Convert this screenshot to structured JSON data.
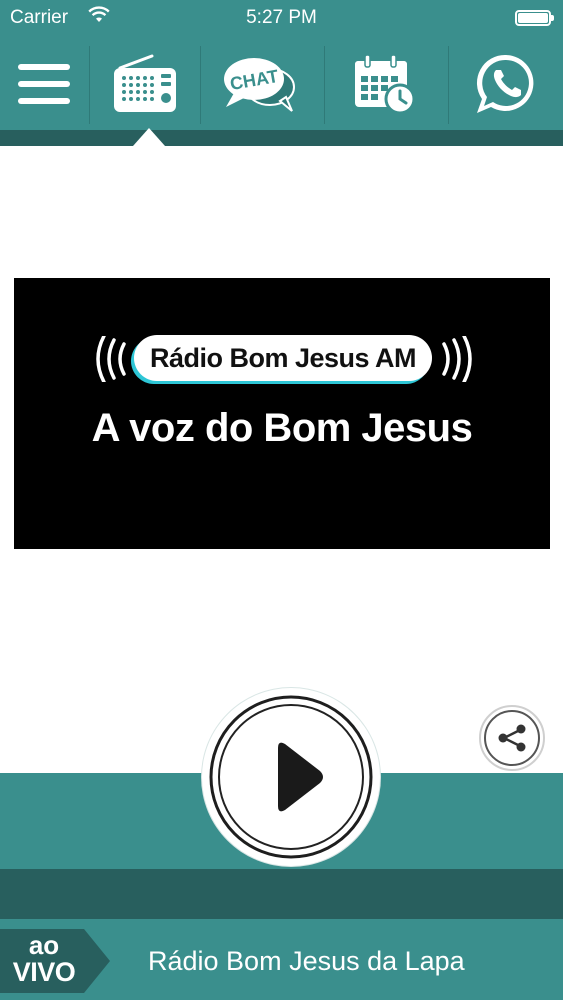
{
  "status_bar": {
    "carrier": "Carrier",
    "time": "5:27 PM"
  },
  "toolbar": {
    "tabs": [
      {
        "icon": "menu-icon"
      },
      {
        "icon": "radio-icon",
        "selected": true
      },
      {
        "icon": "chat-icon",
        "label": "CHAT"
      },
      {
        "icon": "calendar-icon"
      },
      {
        "icon": "whatsapp-icon"
      }
    ]
  },
  "banner": {
    "station_name": "Rádio Bom Jesus AM",
    "slogan": "A voz do Bom Jesus"
  },
  "player": {
    "play_icon": "play-icon",
    "share_icon": "share-icon"
  },
  "footer": {
    "live_line1": "ao",
    "live_line2": "VIVO",
    "station_title": "Rádio Bom Jesus da Lapa"
  },
  "colors": {
    "teal": "#3a8f8d",
    "teal_dark": "#285f5e",
    "accent_cyan": "#2ec6d6"
  }
}
